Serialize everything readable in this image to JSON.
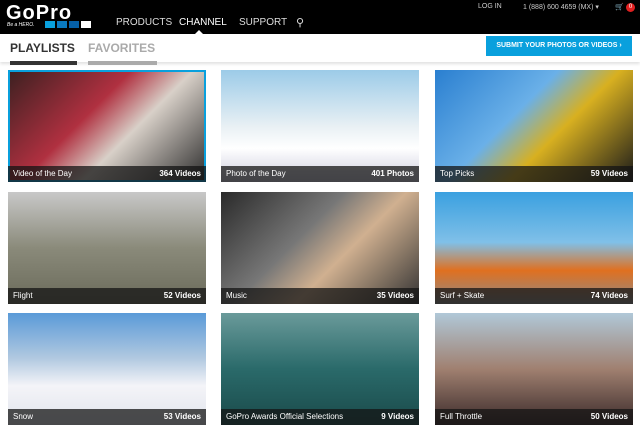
{
  "header": {
    "logo": "GoPro",
    "tagline": "Be a HERO.",
    "nav": [
      "PRODUCTS",
      "CHANNEL",
      "SUPPORT"
    ],
    "active_nav": "CHANNEL",
    "login": "LOG IN",
    "phone": "1 (888) 600 4659 (MX) ▾",
    "cart_count": "0",
    "search_icon": "⚲"
  },
  "subnav": {
    "tabs": [
      "PLAYLISTS",
      "FAVORITES"
    ],
    "submit": "SUBMIT YOUR PHOTOS OR VIDEOS  ›"
  },
  "playlists": [
    {
      "title": "Video of the Day",
      "count": "364 Videos"
    },
    {
      "title": "Photo of the Day",
      "count": "401 Photos"
    },
    {
      "title": "Top Picks",
      "count": "59 Videos"
    },
    {
      "title": "Flight",
      "count": "52 Videos"
    },
    {
      "title": "Music",
      "count": "35 Videos"
    },
    {
      "title": "Surf + Skate",
      "count": "74 Videos"
    },
    {
      "title": "Snow",
      "count": "53 Videos"
    },
    {
      "title": "GoPro Awards Official Selections",
      "count": "9 Videos"
    },
    {
      "title": "Full Throttle",
      "count": "50 Videos"
    }
  ]
}
